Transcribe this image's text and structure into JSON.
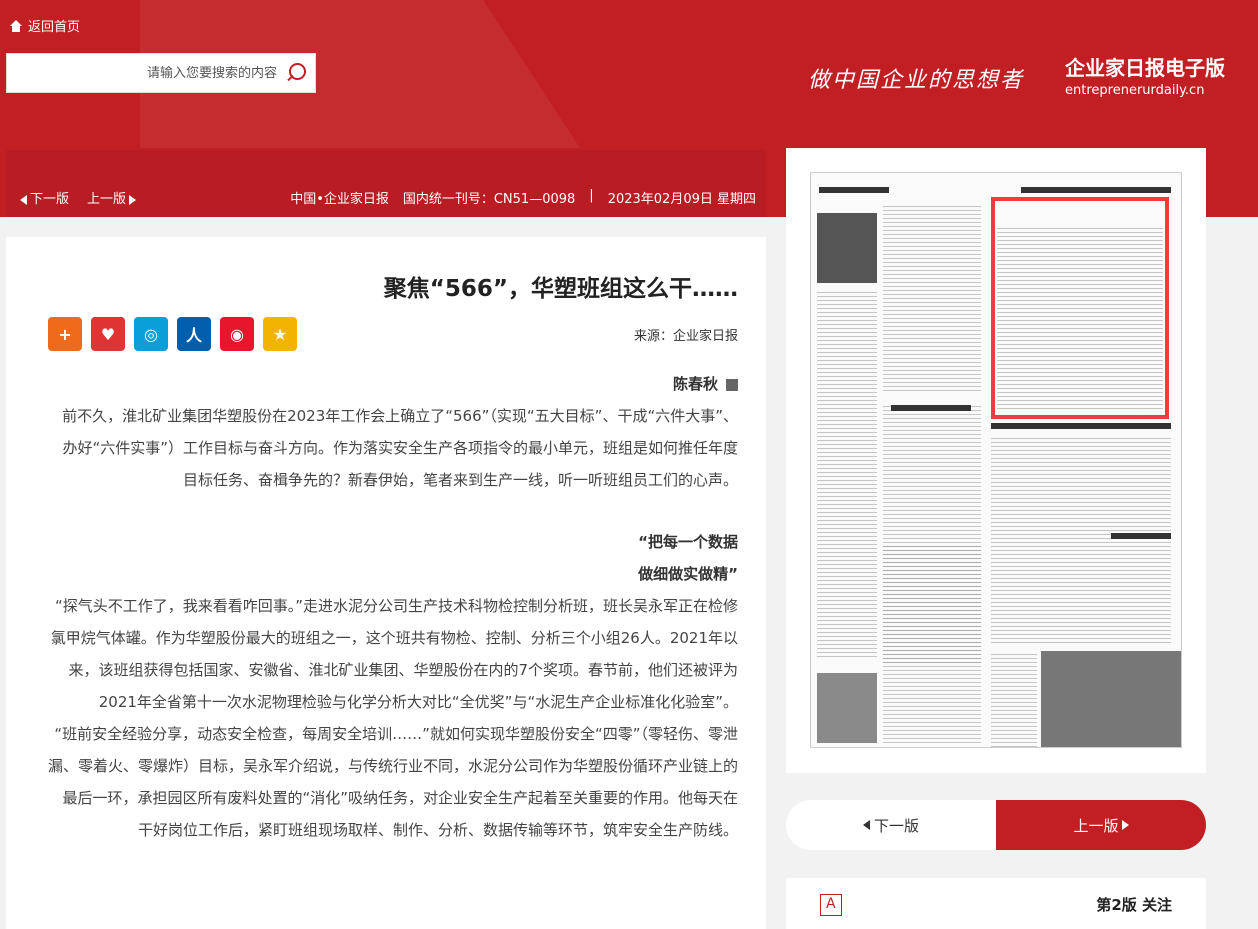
{
  "header": {
    "home_label": "返回首页",
    "search_placeholder": "请输入您要搜索的内容",
    "slogan": "做中国企业的思想者",
    "brand_cn": "企业家日报电子版",
    "brand_en": "entreprenerurdaily.cn",
    "accent_color": "#c21f24"
  },
  "infobar": {
    "prev_label": "上一版",
    "next_label": "下一版",
    "date": "2023年02月09日 星期四",
    "issn": "国内统一刊号：CN51—0098",
    "paper_name": "中国•企业家日报"
  },
  "article": {
    "title": "聚焦“566”，华塑班组这么干……",
    "source": "来源：企业家日报",
    "author": "陈春秋",
    "paragraphs": [
      "前不久，淮北矿业集团华塑股份在2023年工作会上确立了“566”（实现“五大目标”、干成“六件大事”、办好“六件实事”）工作目标与奋斗方向。作为落实安全生产各项指令的最小单元，班组是如何推任年度目标任务、奋楫争先的？新春伊始，笔者来到生产一线，听一听班组员工们的心声。"
    ],
    "subheads": [
      "“把每一个数据",
      "做细做实做精”"
    ],
    "paragraphs2": [
      "“探气头不工作了，我来看看咋回事。”走进水泥分公司生产技术科物检控制分析班，班长吴永军正在检修氯甲烷气体罐。作为华塑股份最大的班组之一，这个班共有物检、控制、分析三个小组26人。2021年以来，该班组获得包括国家、安徽省、淮北矿业集团、华塑股份在内的7个奖项。春节前，他们还被评为2021年全省第十一次水泥物理检验与化学分析大对比“全优奖”与“水泥生产企业标准化化验室”。",
      "“班前安全经验分享，动态安全检查，每周安全培训……”就如何实现华塑股份安全“四零”（零轻伤、零泄漏、零着火、零爆炸）目标，吴永军介绍说，与传统行业不同，水泥分公司作为华塑股份循环产业链上的最后一环，承担园区所有废料处置的“消化”吸纳任务，对企业安全生产起着至关重要的作用。他每天在干好岗位工作后，紧盯班组现场取样、制作、分析、数据传输等环节，筑牢安全生产防线。"
    ]
  },
  "sidebar": {
    "prev_label": "上一版",
    "next_label": "下一版",
    "page_title": "第2版 关注"
  },
  "share_icons": [
    {
      "name": "qzone-icon",
      "color": "#f2b400",
      "glyph": "★"
    },
    {
      "name": "weibo-icon",
      "color": "#e6162d",
      "glyph": "◉"
    },
    {
      "name": "renren-icon",
      "color": "#005eac",
      "glyph": "人"
    },
    {
      "name": "tqq-icon",
      "color": "#0a9fd8",
      "glyph": "◎"
    },
    {
      "name": "douban-icon",
      "color": "#e03434",
      "glyph": "♥"
    },
    {
      "name": "more-icon",
      "color": "#f06a1b",
      "glyph": "+"
    }
  ]
}
